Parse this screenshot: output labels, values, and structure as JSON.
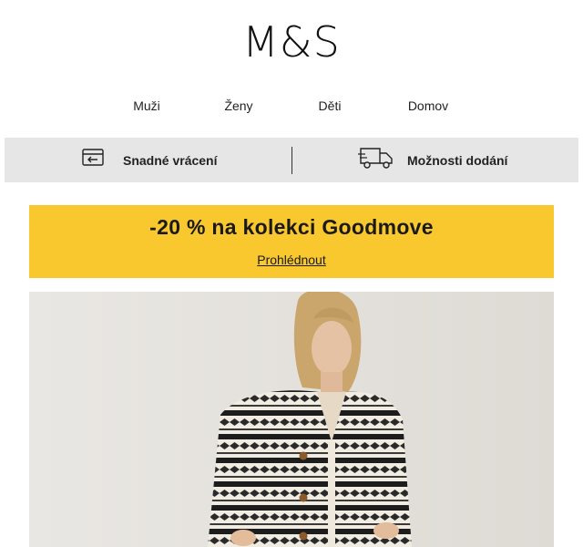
{
  "brand": {
    "logo_text": "M&S"
  },
  "nav": {
    "items": [
      {
        "label": "Muži"
      },
      {
        "label": "Ženy"
      },
      {
        "label": "Děti"
      },
      {
        "label": "Domov"
      }
    ]
  },
  "benefits": {
    "returns": {
      "label": "Snadné vrácení",
      "icon": "return-card-icon"
    },
    "delivery": {
      "label": "Možnosti dodání",
      "icon": "delivery-truck-icon"
    }
  },
  "promo": {
    "title": "-20 % na kolekci Goodmove",
    "link_label": "Prohlédnout",
    "background": "#f9c82f"
  },
  "hero": {
    "image": "woman-in-striped-knit-cardigan"
  },
  "colors": {
    "benefits_bar": "#e6e6e6",
    "text": "#111111"
  }
}
